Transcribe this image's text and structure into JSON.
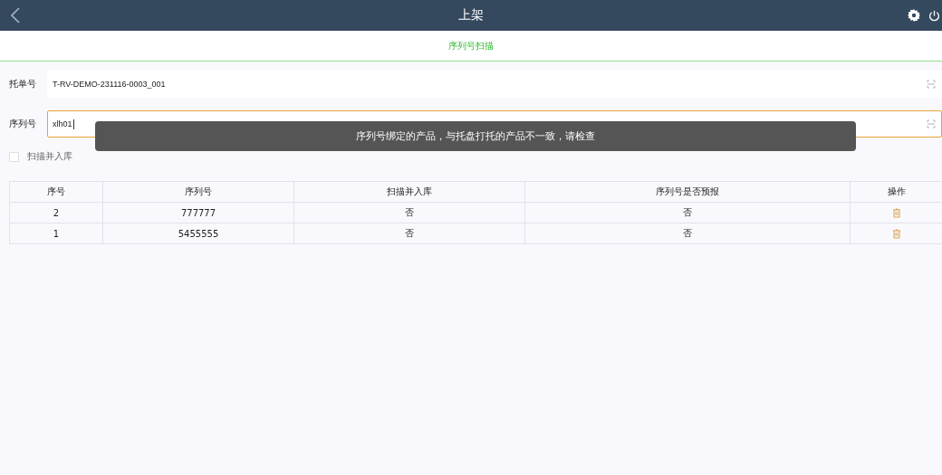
{
  "header": {
    "title": "上架"
  },
  "tabs": [
    {
      "label": "序列号扫描",
      "selected": true
    }
  ],
  "form": {
    "pallet": {
      "label": "托单号",
      "value": "T-RV-DEMO-231116-0003_001"
    },
    "serial": {
      "label": "序列号",
      "value": "xlh01",
      "focused": true
    },
    "scan_store": {
      "label": "扫描并入库",
      "checked": false
    }
  },
  "toast": "序列号绑定的产品，与托盘打托的产品不一致，请检查",
  "table": {
    "columns": [
      "序号",
      "序列号",
      "扫描并入库",
      "序列号是否预报",
      "操作"
    ],
    "rows": [
      {
        "cells": [
          "2",
          "777777",
          "否",
          "否"
        ]
      },
      {
        "cells": [
          "1",
          "5455555",
          "否",
          "否"
        ]
      }
    ]
  }
}
